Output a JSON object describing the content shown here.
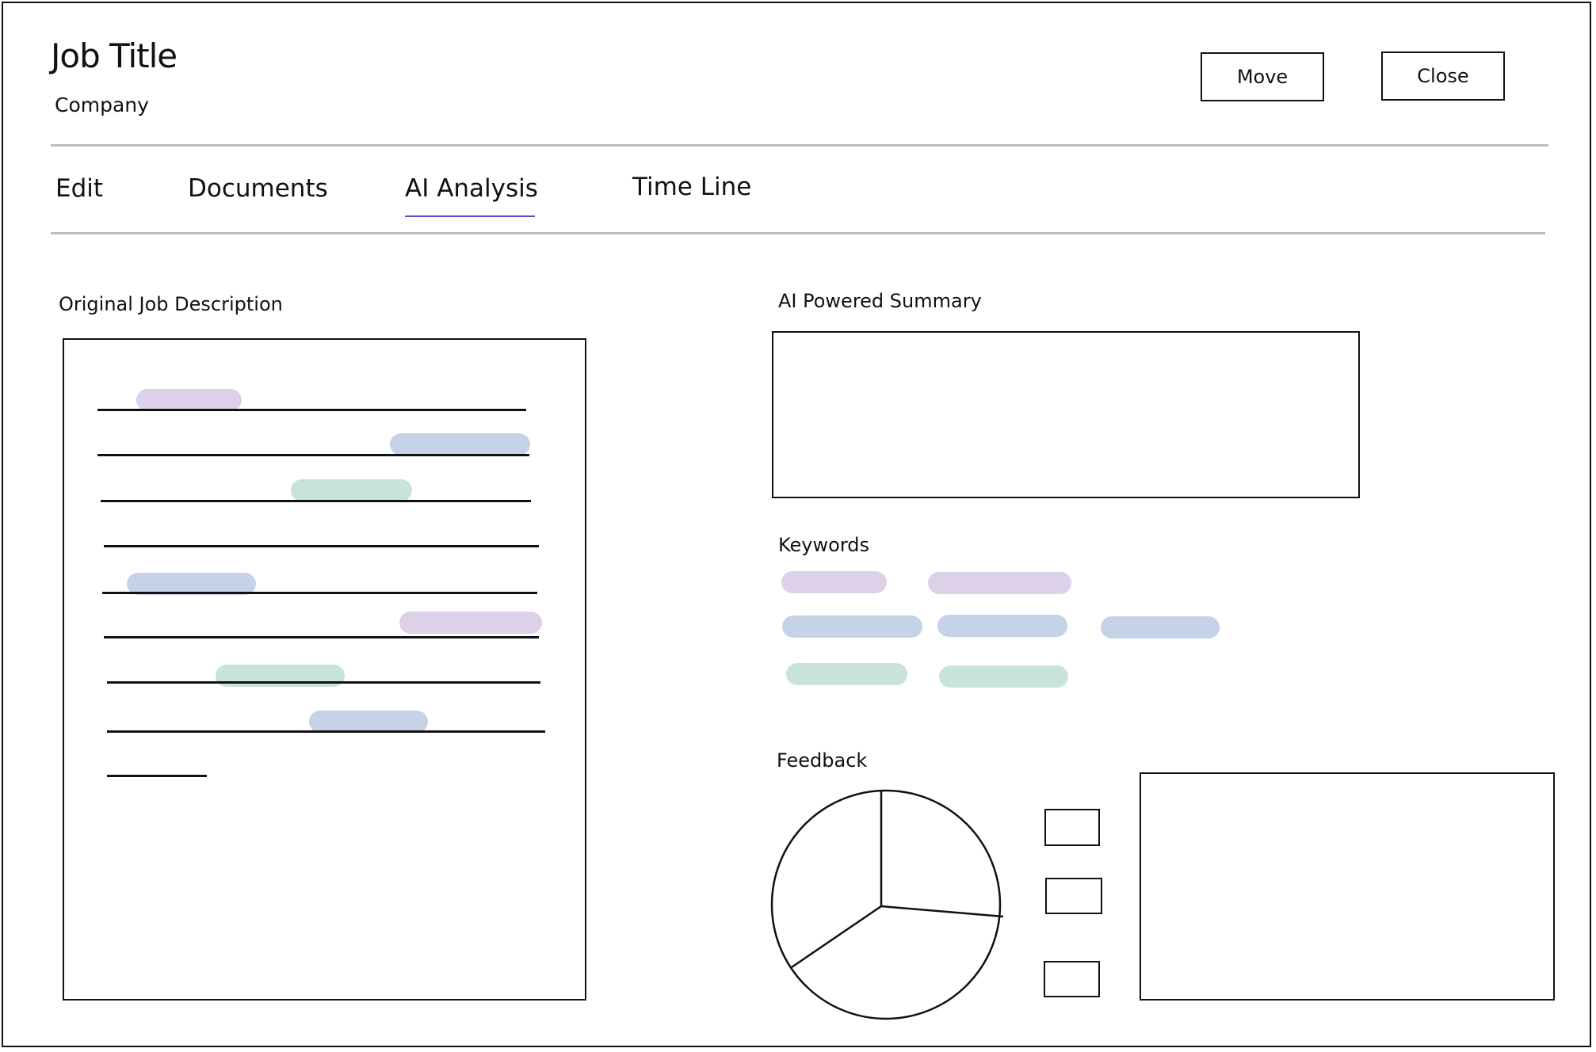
{
  "header": {
    "title": "Job Title",
    "subtitle": "Company",
    "move_label": "Move",
    "close_label": "Close"
  },
  "tabs": [
    {
      "label": "Edit",
      "active": false
    },
    {
      "label": "Documents",
      "active": false
    },
    {
      "label": "AI Analysis",
      "active": true
    },
    {
      "label": "Time Line",
      "active": false
    }
  ],
  "colors": {
    "purple": "#ddd1ea",
    "blue": "#c5d2e8",
    "green": "#c8e4da",
    "active_tab_underline": "#5a4fcf",
    "divider": "#bdbdbd"
  },
  "sections": {
    "original": {
      "label": "Original Job Description",
      "line_count": 9
    },
    "summary": {
      "label": "AI Powered Summary"
    },
    "keywords": {
      "label": "Keywords",
      "count": 7
    },
    "feedback": {
      "label": "Feedback",
      "legend_count": 3,
      "pie_slices": 3
    }
  }
}
